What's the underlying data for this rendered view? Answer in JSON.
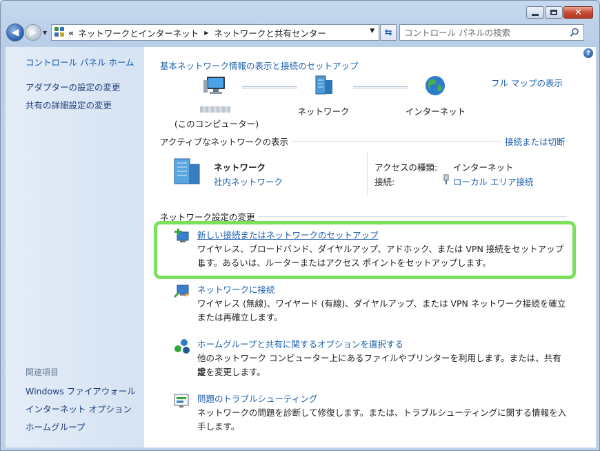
{
  "window": {
    "caption": {
      "minimize": "minimize",
      "maximize": "maximize",
      "close": "✕"
    }
  },
  "navbar": {
    "back": "◀",
    "forward": "▶",
    "chevrons": "«",
    "breadcrumb": [
      "ネットワークとインターネット",
      "ネットワークと共有センター"
    ],
    "crumb_sep": "▶",
    "dropdown": "▼",
    "refresh": "⇆",
    "search_placeholder": "コントロール パネルの検索"
  },
  "sidebar": {
    "home": "コントロール パネル ホーム",
    "links": [
      "アダプターの設定の変更",
      "共有の詳細設定の変更"
    ],
    "related_heading": "関連項目",
    "related": [
      "Windows ファイアウォール",
      "インターネット オプション",
      "ホームグループ"
    ]
  },
  "main": {
    "help": "?",
    "heading": "基本ネットワーク情報の表示と接続のセットアップ",
    "full_map": "フル マップの表示",
    "map": {
      "computer_sub": "(このコンピューター)",
      "network": "ネットワーク",
      "internet": "インターネット"
    },
    "active": {
      "title": "アクティブなネットワークの表示",
      "connect_link": "接続または切断",
      "network_name": "ネットワーク",
      "network_type": "社内ネットワーク",
      "access_label": "アクセスの種類:",
      "access_value": "インターネット",
      "conn_label": "接続:",
      "conn_value": "ローカル エリア接続"
    },
    "change": {
      "title": "ネットワーク設定の変更",
      "items": [
        {
          "link": "新しい接続またはネットワークのセットアップ",
          "desc1": "ワイヤレス、ブロードバンド、ダイヤルアップ、アドホック、または VPN 接続をセットアップし",
          "desc2": "ます。あるいは、ルーターまたはアクセス ポイントをセットアップします。"
        },
        {
          "link": "ネットワークに接続",
          "desc1": "ワイヤレス (無線)、ワイヤード (有線)、ダイヤルアップ、または VPN ネットワーク接続を確立",
          "desc2": "または再確立します。"
        },
        {
          "link": "ホームグループと共有に関するオプションを選択する",
          "desc1": "他のネットワーク コンピューター上にあるファイルやプリンターを利用します。または、共有設",
          "desc2": "定を変更します。"
        },
        {
          "link": "問題のトラブルシューティング",
          "desc1": "ネットワークの問題を診断して修復します。または、トラブルシューティングに関する情報を入",
          "desc2": "手します。"
        }
      ]
    }
  },
  "colors": {
    "link": "#1c5fae",
    "highlight": "#7be15c",
    "sidebar_text": "#1d3c78"
  }
}
